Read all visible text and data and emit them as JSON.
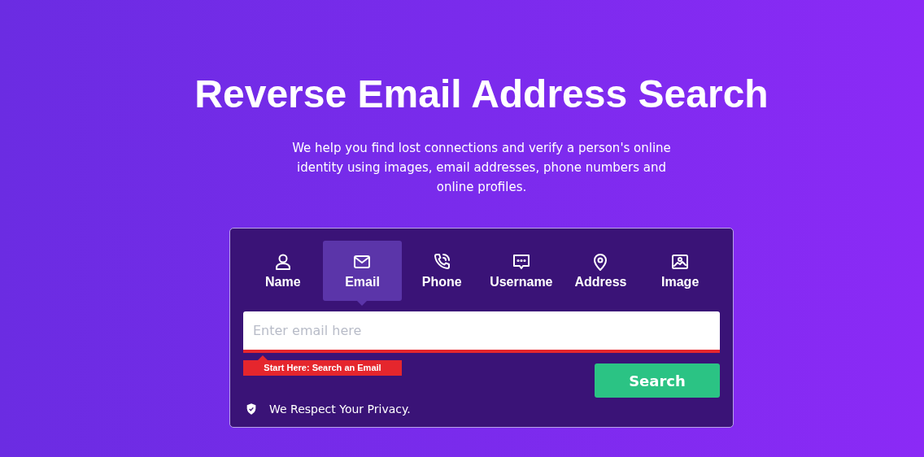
{
  "title": "Reverse Email Address Search",
  "subtitle": "We help you find lost connections and verify a person's online identity using images, email addresses, phone numbers and online profiles.",
  "tabs": [
    {
      "label": "Name",
      "kind": "person",
      "selected": false
    },
    {
      "label": "Email",
      "kind": "mail",
      "selected": true
    },
    {
      "label": "Phone",
      "kind": "phone",
      "selected": false
    },
    {
      "label": "Username",
      "kind": "chat",
      "selected": false
    },
    {
      "label": "Address",
      "kind": "pin",
      "selected": false
    },
    {
      "label": "Image",
      "kind": "image",
      "selected": false
    }
  ],
  "search": {
    "placeholder": "Enter email here"
  },
  "hint": "Start Here: Search an Email",
  "button": "Search",
  "privacy": "We Respect Your Privacy."
}
